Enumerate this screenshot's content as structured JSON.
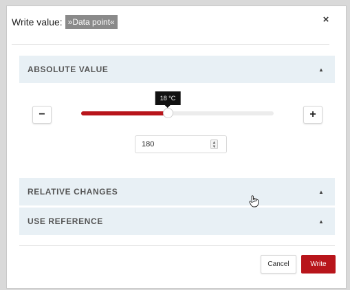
{
  "dialog": {
    "title": "Write value:",
    "title_chip": "»Data point«",
    "close_label": "×"
  },
  "sections": {
    "absolute": {
      "label": "ABSOLUTE VALUE",
      "caret": "▲",
      "expanded": true
    },
    "relative": {
      "label": "RELATIVE CHANGES",
      "caret": "▲"
    },
    "reference": {
      "label": "USE REFERENCE",
      "caret": "▲"
    }
  },
  "slider": {
    "tooltip": "18 °C",
    "level": 0.45,
    "minus_label": "−",
    "plus_label": "+"
  },
  "number_input": {
    "value": "180",
    "spin_up": "▲",
    "spin_down": "▼"
  },
  "footer": {
    "cancel_label": "Cancel",
    "write_label": "Write"
  },
  "colors": {
    "accent": "#b8151b",
    "section_header_bg": "#e8f0f5"
  },
  "icons": {
    "close": "close-icon",
    "caret": "chevron-up-icon",
    "cursor": "hand-cursor-icon"
  }
}
